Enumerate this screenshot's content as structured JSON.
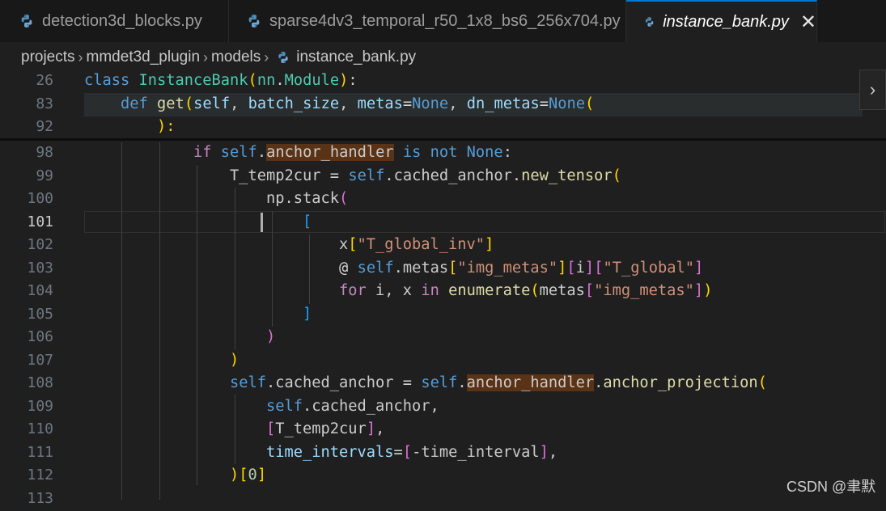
{
  "tabs": [
    {
      "label": "detection3d_blocks.py",
      "active": false
    },
    {
      "label": "sparse4dv3_temporal_r50_1x8_bs6_256x704.py",
      "active": false
    },
    {
      "label": "instance_bank.py",
      "active": true
    }
  ],
  "close_glyph": "✕",
  "breadcrumb": [
    "projects",
    "mmdet3d_plugin",
    "models",
    "instance_bank.py"
  ],
  "breadcrumb_sep": "›",
  "icons": {
    "file_type": "python-icon",
    "close": "close-icon",
    "expand": "chevron-right-icon"
  },
  "expand_glyph": "›",
  "current_line": "101",
  "lines": [
    {
      "n": "26",
      "tokens": [
        [
          "kw",
          "class"
        ],
        [
          "",
          " "
        ],
        [
          "cls",
          "InstanceBank"
        ],
        [
          "b1",
          "("
        ],
        [
          "cls",
          "nn"
        ],
        [
          "op",
          "."
        ],
        [
          "cls",
          "Module"
        ],
        [
          "b1",
          ")"
        ],
        [
          "",
          ":"
        ]
      ]
    },
    {
      "n": "83",
      "tokens": [
        [
          "",
          "    "
        ],
        [
          "kw",
          "def"
        ],
        [
          "",
          " "
        ],
        [
          "fn",
          "get"
        ],
        [
          "b1",
          "("
        ],
        [
          "var",
          "self"
        ],
        [
          "",
          ", "
        ],
        [
          "var",
          "batch_size"
        ],
        [
          "",
          ", "
        ],
        [
          "var",
          "metas"
        ],
        [
          "op",
          "="
        ],
        [
          "kw",
          "None"
        ],
        [
          "",
          ", "
        ],
        [
          "var",
          "dn_metas"
        ],
        [
          "op",
          "="
        ],
        [
          "kw",
          "None"
        ],
        [
          "b1",
          "("
        ]
      ]
    },
    {
      "n": "92",
      "tokens": [
        [
          "",
          "        "
        ],
        [
          "b1",
          "):"
        ]
      ]
    },
    {
      "n": "98",
      "tokens": [
        [
          "",
          "            "
        ],
        [
          "kw2",
          "if"
        ],
        [
          "",
          " "
        ],
        [
          "kw",
          "self"
        ],
        [
          "",
          "."
        ],
        [
          "hl",
          "anchor_handler"
        ],
        [
          "",
          " "
        ],
        [
          "kw",
          "is"
        ],
        [
          "",
          " "
        ],
        [
          "kw",
          "not"
        ],
        [
          "",
          " "
        ],
        [
          "kw",
          "None"
        ],
        [
          "",
          ":"
        ]
      ]
    },
    {
      "n": "99",
      "tokens": [
        [
          "",
          "                T_temp2cur "
        ],
        [
          "op",
          "="
        ],
        [
          "",
          " "
        ],
        [
          "kw",
          "self"
        ],
        [
          "",
          ".cached_anchor."
        ],
        [
          "fn",
          "new_tensor"
        ],
        [
          "b1",
          "("
        ]
      ]
    },
    {
      "n": "100",
      "tokens": [
        [
          "",
          "                    np.stack"
        ],
        [
          "b2",
          "("
        ]
      ]
    },
    {
      "n": "101",
      "tokens": [
        [
          "",
          "                        "
        ],
        [
          "b3",
          "["
        ]
      ]
    },
    {
      "n": "102",
      "tokens": [
        [
          "",
          "                            x"
        ],
        [
          "b1",
          "["
        ],
        [
          "str",
          "\"T_global_inv\""
        ],
        [
          "b1",
          "]"
        ]
      ]
    },
    {
      "n": "103",
      "tokens": [
        [
          "",
          "                            "
        ],
        [
          "op",
          "@"
        ],
        [
          "",
          " "
        ],
        [
          "kw",
          "self"
        ],
        [
          "",
          ".metas"
        ],
        [
          "b1",
          "["
        ],
        [
          "str",
          "\"img_metas\""
        ],
        [
          "b1",
          "]"
        ],
        [
          "b2",
          "["
        ],
        [
          "",
          "i"
        ],
        [
          "b2",
          "]"
        ],
        [
          "b2",
          "["
        ],
        [
          "str",
          "\"T_global\""
        ],
        [
          "b2",
          "]"
        ]
      ]
    },
    {
      "n": "104",
      "tokens": [
        [
          "",
          "                            "
        ],
        [
          "kw2",
          "for"
        ],
        [
          "",
          " i, x "
        ],
        [
          "kw2",
          "in"
        ],
        [
          "",
          " "
        ],
        [
          "fn",
          "enumerate"
        ],
        [
          "b1",
          "("
        ],
        [
          "",
          "metas"
        ],
        [
          "b2",
          "["
        ],
        [
          "str",
          "\"img_metas\""
        ],
        [
          "b2",
          "]"
        ],
        [
          "b1",
          ")"
        ]
      ]
    },
    {
      "n": "105",
      "tokens": [
        [
          "",
          "                        "
        ],
        [
          "b3",
          "]"
        ]
      ]
    },
    {
      "n": "106",
      "tokens": [
        [
          "",
          "                    "
        ],
        [
          "b2",
          ")"
        ]
      ]
    },
    {
      "n": "107",
      "tokens": [
        [
          "",
          "                "
        ],
        [
          "b1",
          ")"
        ]
      ]
    },
    {
      "n": "108",
      "tokens": [
        [
          "",
          "                "
        ],
        [
          "kw",
          "self"
        ],
        [
          "",
          ".cached_anchor "
        ],
        [
          "op",
          "="
        ],
        [
          "",
          " "
        ],
        [
          "kw",
          "self"
        ],
        [
          "",
          "."
        ],
        [
          "hl",
          "anchor_handler"
        ],
        [
          "",
          "."
        ],
        [
          "fn",
          "anchor_projection"
        ],
        [
          "b1",
          "("
        ]
      ]
    },
    {
      "n": "109",
      "tokens": [
        [
          "",
          "                    "
        ],
        [
          "kw",
          "self"
        ],
        [
          "",
          ".cached_anchor,"
        ]
      ]
    },
    {
      "n": "110",
      "tokens": [
        [
          "",
          "                    "
        ],
        [
          "b2",
          "["
        ],
        [
          "",
          "T_temp2cur"
        ],
        [
          "b2",
          "]"
        ],
        [
          "",
          ","
        ]
      ]
    },
    {
      "n": "111",
      "tokens": [
        [
          "",
          "                    "
        ],
        [
          "var",
          "time_intervals"
        ],
        [
          "op",
          "="
        ],
        [
          "b2",
          "["
        ],
        [
          "op",
          "-"
        ],
        [
          "",
          "time_interval"
        ],
        [
          "b2",
          "]"
        ],
        [
          "",
          ","
        ]
      ]
    },
    {
      "n": "112",
      "tokens": [
        [
          "",
          "                "
        ],
        [
          "b1",
          ")"
        ],
        [
          "b1",
          "["
        ],
        [
          "num",
          "0"
        ],
        [
          "b1",
          "]"
        ]
      ]
    },
    {
      "n": "113",
      "tokens": []
    }
  ],
  "watermark": "CSDN @聿默",
  "colors": {
    "background": "#1f1f1f",
    "tab_accent": "#0078d4",
    "highlight": "#5a3215"
  }
}
